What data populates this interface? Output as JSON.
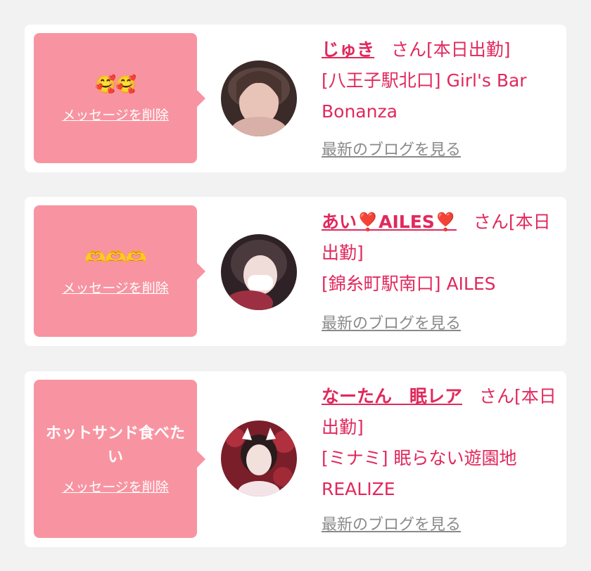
{
  "cards": [
    {
      "message": "",
      "reaction": "🥰🥰",
      "delete_label": "メッセージを削除",
      "name": "じゅき",
      "suffix": "さん[本日出勤]",
      "shop": "[八王子駅北口] Girl's Bar Bonanza",
      "blog_label": "最新のブログを見る"
    },
    {
      "message": "",
      "reaction": "🫶🫶🫶",
      "delete_label": "メッセージを削除",
      "name": "あい❣️AILES❣️",
      "suffix": "さん[本日出勤]",
      "shop": "[錦糸町駅南口] AILES",
      "blog_label": "最新のブログを見る"
    },
    {
      "message": "ホットサンド食べたい",
      "reaction": "",
      "delete_label": "メッセージを削除",
      "name": "なーたん　眠レア",
      "suffix": "さん[本日出勤]",
      "shop": "[ミナミ] 眠らない遊園地 REALIZE",
      "blog_label": "最新のブログを見る"
    }
  ],
  "colors": {
    "bubble": "#f894a1",
    "accent": "#e0295c",
    "link_gray": "#8a8a8a",
    "background": "#f2f2f2"
  }
}
